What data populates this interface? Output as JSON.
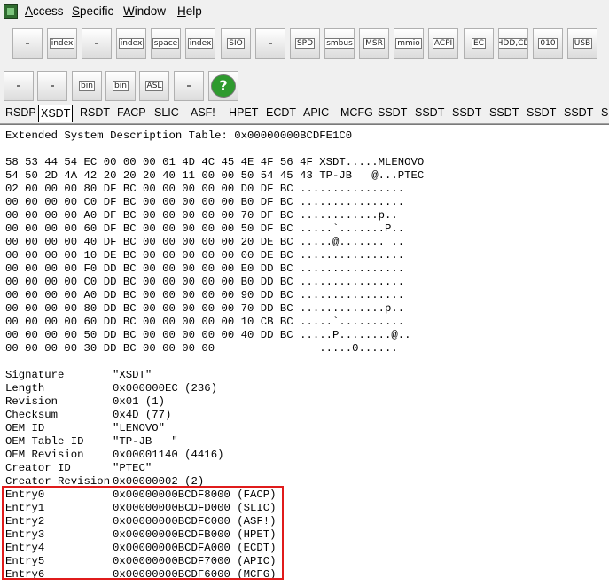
{
  "menu": [
    {
      "label": "Access",
      "accel": "A",
      "rest": "ccess"
    },
    {
      "label": "Specific",
      "accel": "S",
      "rest": "pecific"
    },
    {
      "label": "Window",
      "accel": "W",
      "rest": "indow"
    },
    {
      "label": "Help",
      "accel": "H",
      "rest": "elp"
    }
  ],
  "toolbar1": [
    "pci-icon",
    "index-pci-icon",
    "memory-icon",
    "index-memory-icon",
    "space-icon",
    "index-space-icon",
    "sio-icon",
    "waveform-icon",
    "spd-icon",
    "smbus-icon",
    "msr-icon",
    "mmio-icon",
    "acpi-icon",
    "ec-icon",
    "hdd-cd-icon",
    "binary-icon",
    "usb-icon"
  ],
  "toolbar1_labels": [
    "",
    "index",
    "",
    "index",
    "space",
    "index",
    "SIO",
    "",
    "SPD",
    "smbus",
    "MSR",
    "mmio",
    "ACPI",
    "EC",
    "HDD,CD",
    "010",
    "USB"
  ],
  "toolbar2_labels": [
    "",
    "",
    "bin",
    "bin",
    "ASL",
    "",
    ""
  ],
  "tabs": [
    "RSDP",
    "XSDT",
    "RSDT",
    "FACP",
    "SLIC",
    "ASF!",
    "HPET",
    "ECDT",
    "APIC",
    "MCFG",
    "SSDT",
    "SSDT",
    "SSDT",
    "SSDT",
    "SSDT",
    "SSDT",
    "SS"
  ],
  "active_tab": "XSDT",
  "content": {
    "header": "Extended System Description Table: 0x00000000BCDFE1C0",
    "hex_rows": [
      "58 53 44 54 EC 00 00 00 01 4D 4C 45 4E 4F 56 4F XSDT.....MLENOVO",
      "54 50 2D 4A 42 20 20 20 40 11 00 00 50 54 45 43 TP-JB   @...PTEC",
      "02 00 00 00 80 DF BC 00 00 00 00 00 D0 DF BC ................",
      "00 00 00 00 C0 DF BC 00 00 00 00 00 B0 DF BC ................",
      "00 00 00 00 A0 DF BC 00 00 00 00 00 70 DF BC ............p..",
      "00 00 00 00 60 DF BC 00 00 00 00 00 50 DF BC .....`.......P..",
      "00 00 00 00 40 DF BC 00 00 00 00 00 20 DE BC .....@....... ..",
      "00 00 00 00 10 DE BC 00 00 00 00 00 00 DE BC ................",
      "00 00 00 00 F0 DD BC 00 00 00 00 00 E0 DD BC ................",
      "00 00 00 00 C0 DD BC 00 00 00 00 00 B0 DD BC ................",
      "00 00 00 00 A0 DD BC 00 00 00 00 00 90 DD BC ................",
      "00 00 00 00 80 DD BC 00 00 00 00 00 70 DD BC .............p..",
      "00 00 00 00 60 DD BC 00 00 00 00 00 10 CB BC .....`..........",
      "00 00 00 00 50 DD BC 00 00 00 00 00 40 DD BC .....P........@..",
      "00 00 00 00 30 DD BC 00 00 00 00                .....0......"
    ],
    "fields": [
      {
        "name": "Signature",
        "value": "\"XSDT\""
      },
      {
        "name": "Length",
        "value": "0x000000EC (236)"
      },
      {
        "name": "Revision",
        "value": "0x01 (1)"
      },
      {
        "name": "Checksum",
        "value": "0x4D (77)"
      },
      {
        "name": "OEM ID",
        "value": "\"LENOVO\""
      },
      {
        "name": "OEM Table ID",
        "value": "\"TP-JB   \""
      },
      {
        "name": "OEM Revision",
        "value": "0x00001140 (4416)"
      },
      {
        "name": "Creator ID",
        "value": "\"PTEC\""
      },
      {
        "name": "Creator Revision",
        "value": "0x00000002 (2)"
      }
    ],
    "entries": [
      {
        "name": "Entry0",
        "value": "0x00000000BCDF8000 (FACP)"
      },
      {
        "name": "Entry1",
        "value": "0x00000000BCDFD000 (SLIC)"
      },
      {
        "name": "Entry2",
        "value": "0x00000000BCDFC000 (ASF!)"
      },
      {
        "name": "Entry3",
        "value": "0x00000000BCDFB000 (HPET)"
      },
      {
        "name": "Entry4",
        "value": "0x00000000BCDFA000 (ECDT)"
      },
      {
        "name": "Entry5",
        "value": "0x00000000BCDF7000 (APIC)"
      },
      {
        "name": "Entry6",
        "value": "0x00000000BCDF6000 (MCFG)"
      }
    ]
  },
  "colors": {
    "highlight": "#e01b1b",
    "window": "#f0f0f0"
  }
}
